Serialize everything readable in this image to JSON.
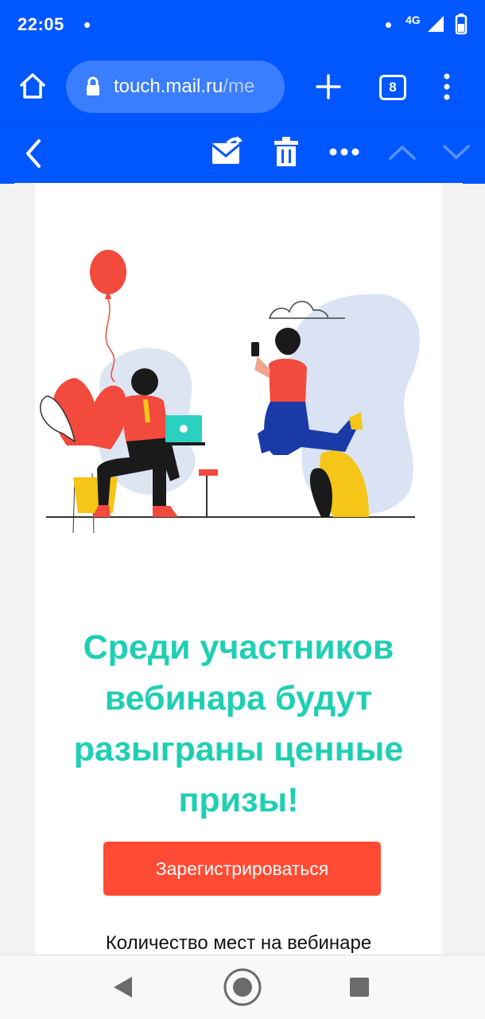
{
  "status_bar": {
    "time": "22:05",
    "network": "4G"
  },
  "browser": {
    "url_host": "touch.mail.ru",
    "url_rest": "/me",
    "tab_count": "8"
  },
  "email": {
    "headline_lines": [
      "Среди участников",
      "вебинара будут",
      "разыграны ценные",
      "призы!"
    ],
    "register_button": "Зарегистрироваться",
    "seats_text": "Количество мест на вебинаре"
  },
  "colors": {
    "primary_blue": "#0057ff",
    "headline_teal": "#1fcfb3",
    "button_red": "#ff4b33"
  }
}
